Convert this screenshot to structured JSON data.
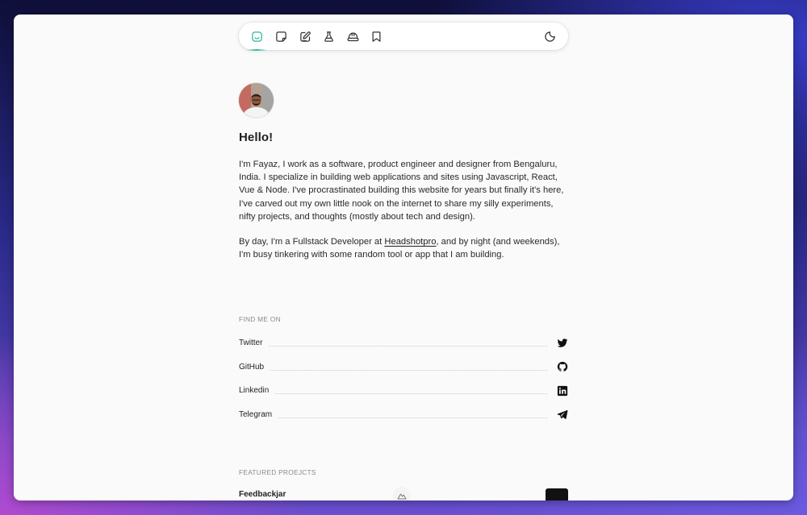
{
  "nav": {
    "items": [
      {
        "name": "home",
        "icon": "smile-icon",
        "active": true
      },
      {
        "name": "notes",
        "icon": "sticky-note-icon",
        "active": false
      },
      {
        "name": "writing",
        "icon": "edit-icon",
        "active": false
      },
      {
        "name": "lab",
        "icon": "flask-icon",
        "active": false
      },
      {
        "name": "stack",
        "icon": "hard-hat-icon",
        "active": false
      },
      {
        "name": "bookmarks",
        "icon": "bookmark-icon",
        "active": false
      }
    ],
    "theme_toggle_icon": "moon-icon",
    "accent": "#2bb5a0"
  },
  "profile": {
    "greeting": "Hello!",
    "bio_paragraph_1": "I'm Fayaz, I work as a software, product engineer and designer from Bengaluru, India. I specialize in building web applications and sites using Javascript, React, Vue & Node. I've procrastinated building this website for years but finally it's here, I've carved out my own little nook on the internet to share my silly experiments, nifty projects, and thoughts (mostly about tech and design).",
    "bio_p2_before": "By day, I'm a Fullstack Developer at ",
    "bio_p2_link": "Headshotpro",
    "bio_p2_after": ", and by night (and weekends), I'm busy tinkering with some random tool or app that I am building."
  },
  "socials": {
    "title": "FIND ME ON",
    "items": [
      {
        "label": "Twitter",
        "icon": "twitter-icon"
      },
      {
        "label": "GitHub",
        "icon": "github-icon"
      },
      {
        "label": "Linkedin",
        "icon": "linkedin-icon"
      },
      {
        "label": "Telegram",
        "icon": "telegram-icon"
      }
    ]
  },
  "projects": {
    "title": "FEATURED PROEJCTS",
    "items": [
      {
        "name": "Feedbackjar"
      }
    ]
  }
}
